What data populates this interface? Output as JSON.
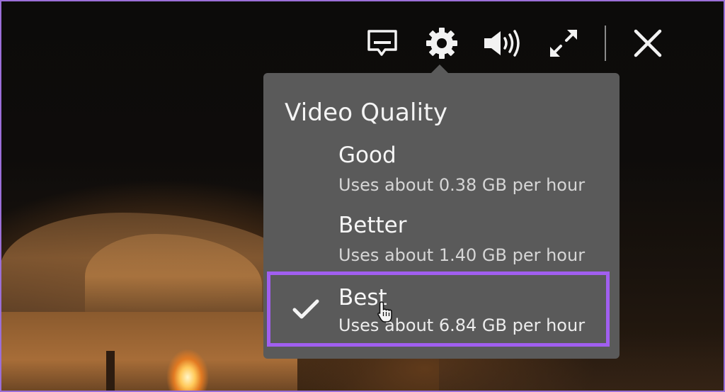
{
  "player": {
    "controls": {
      "subtitles_icon": "subtitles-icon",
      "settings_icon": "gear-icon",
      "volume_icon": "volume-icon",
      "fullscreen_icon": "fullscreen-icon",
      "close_icon": "close-icon"
    }
  },
  "quality_menu": {
    "title": "Video Quality",
    "options": [
      {
        "label": "Good",
        "description": "Uses about 0.38 GB per hour",
        "selected": false
      },
      {
        "label": "Better",
        "description": "Uses about 1.40 GB per hour",
        "selected": false
      },
      {
        "label": "Best",
        "description": "Uses about 6.84 GB per hour",
        "selected": true
      }
    ]
  },
  "colors": {
    "panel_bg": "#5a5a5a",
    "highlight": "#a15ff0",
    "frame_border": "#9b6fd8"
  }
}
